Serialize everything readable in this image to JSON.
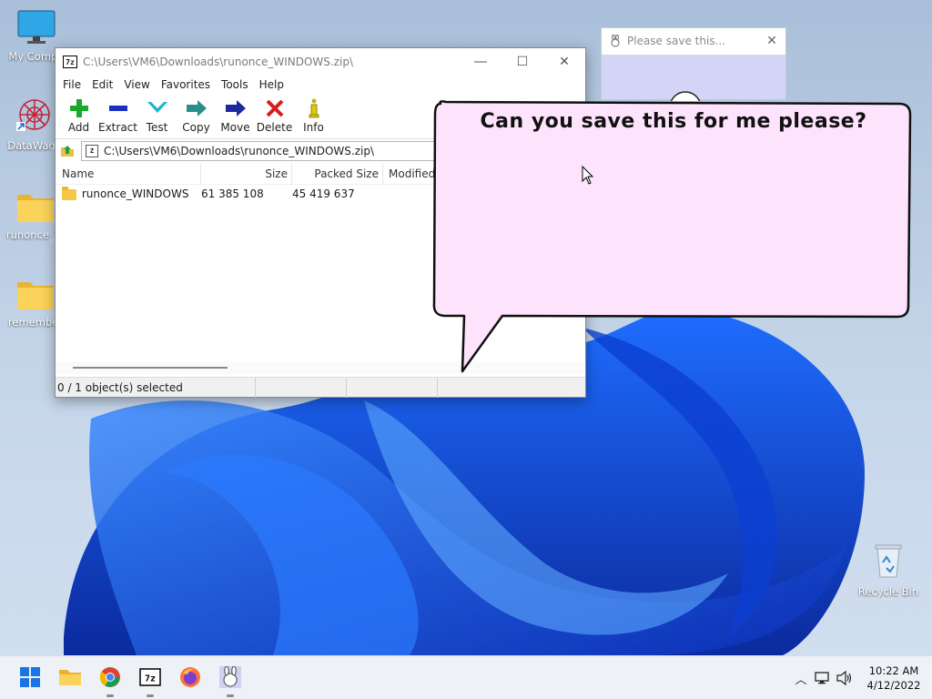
{
  "desktop": {
    "icons": [
      {
        "label": "My Compu"
      },
      {
        "label": "DataWago"
      },
      {
        "label": "runonce_W"
      },
      {
        "label": "remember"
      },
      {
        "label": "Recycle Bin"
      }
    ]
  },
  "sevenzip": {
    "title": "C:\\Users\\VM6\\Downloads\\runonce_WINDOWS.zip\\",
    "app_icon_text": "7z",
    "menu": [
      "File",
      "Edit",
      "View",
      "Favorites",
      "Tools",
      "Help"
    ],
    "toolbar": {
      "add": "Add",
      "extract": "Extract",
      "test": "Test",
      "copy": "Copy",
      "move": "Move",
      "delete": "Delete",
      "info": "Info"
    },
    "address": "C:\\Users\\VM6\\Downloads\\runonce_WINDOWS.zip\\",
    "columns": {
      "name": "Name",
      "size": "Size",
      "packed": "Packed Size",
      "modified": "Modified"
    },
    "rows": [
      {
        "name": "runonce_WINDOWS",
        "size": "61 385 108",
        "packed": "45 419 637"
      }
    ],
    "status": "0 / 1 object(s) selected"
  },
  "dialog": {
    "title": "Please save this..."
  },
  "bubble": {
    "text": "Can you save this for me please?",
    "fill_color": "#fde3fb"
  },
  "taskbar": {
    "time": "10:22 AM",
    "date": "4/12/2022"
  }
}
